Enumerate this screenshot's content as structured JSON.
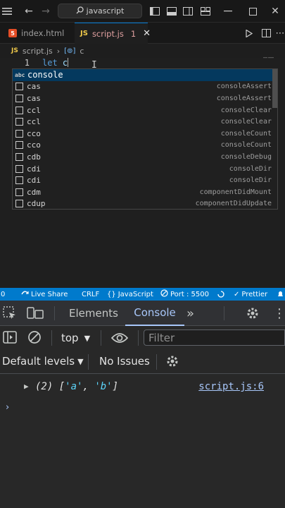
{
  "titlebar": {
    "search_text": "javascript"
  },
  "tabs": [
    {
      "label": "index.html"
    },
    {
      "label": "script.js",
      "badge": "1"
    }
  ],
  "breadcrumb": {
    "file": "script.js",
    "symbol": "c"
  },
  "editor": {
    "line_number": "1",
    "keyword": "let",
    "typed": "c"
  },
  "suggest": {
    "items": [
      {
        "label": "console",
        "detail": ""
      },
      {
        "label": "cas",
        "detail": "consoleAssert"
      },
      {
        "label": "cas",
        "detail": "consoleAssert"
      },
      {
        "label": "ccl",
        "detail": "consoleClear"
      },
      {
        "label": "ccl",
        "detail": "consoleClear"
      },
      {
        "label": "cco",
        "detail": "consoleCount"
      },
      {
        "label": "cco",
        "detail": "consoleCount"
      },
      {
        "label": "cdb",
        "detail": "consoleDebug"
      },
      {
        "label": "cdi",
        "detail": "consoleDir"
      },
      {
        "label": "cdi",
        "detail": "consoleDir"
      },
      {
        "label": "cdm",
        "detail": "componentDidMount"
      },
      {
        "label": "cdup",
        "detail": "componentDidUpdate"
      }
    ]
  },
  "statusbar": {
    "errors": "0",
    "live_share": "Live Share",
    "eol": "CRLF",
    "language": "JavaScript",
    "port": "Port : 5500",
    "prettier": "Prettier"
  },
  "devtools": {
    "tabs": {
      "elements": "Elements",
      "console": "Console"
    },
    "context": "top",
    "filter_placeholder": "Filter",
    "levels": "Default levels",
    "issues": "No Issues",
    "log": {
      "count": "(2)",
      "open": "[",
      "item1": "'a'",
      "sep": ", ",
      "item2": "'b'",
      "close": "]",
      "source": "script.js:6"
    },
    "prompt": "›"
  },
  "colors": {
    "accent": "#007acc",
    "devtools_active": "#a8c7fa",
    "string": "#5cd5fb"
  }
}
